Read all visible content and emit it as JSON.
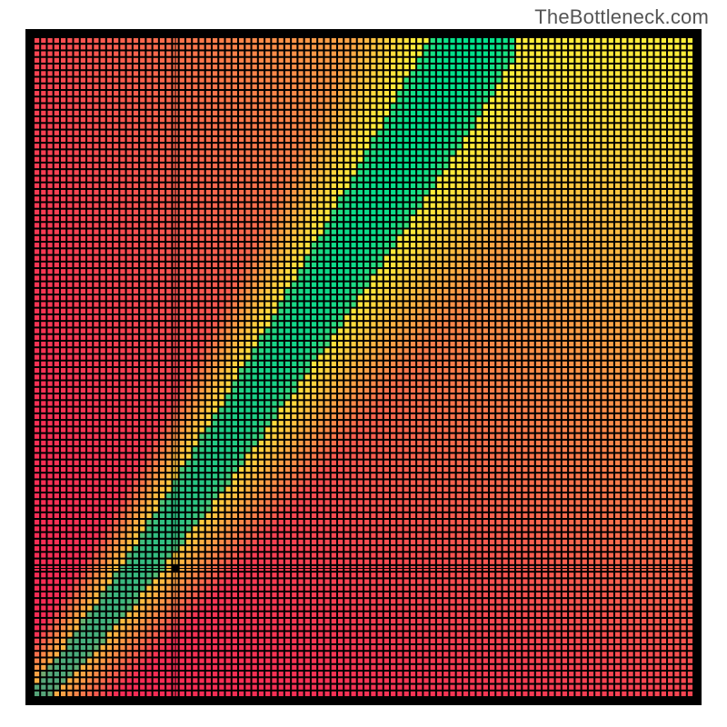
{
  "watermark": "TheBottleneck.com",
  "chart_data": {
    "type": "heatmap",
    "title": "",
    "xlabel": "",
    "ylabel": "",
    "grid": {
      "cells": 100,
      "inner_margin_frac": 0.012
    },
    "ridge": {
      "comment": "Green optimal band runs as a curve from bottom-left toward top-right with slope >1 (steeper than diagonal).",
      "x0": 0.0,
      "y0": 0.0,
      "x1": 0.67,
      "y1": 1.0,
      "curvature": 0.55,
      "width_start": 0.02,
      "width_end": 0.13
    },
    "background_gradient": {
      "comment": "Quadrilinear blend by corner color",
      "bottom_left": "#f72c56",
      "bottom_right": "#f72c56",
      "top_left": "#f72c56",
      "top_right": "#ffe93f"
    },
    "ridge_color": "#00e48d",
    "halo_color": "#fff23a",
    "crosshair": {
      "x_frac": 0.215,
      "y_frac": 0.195,
      "marker_radius_px": 4
    },
    "xlim": [
      0,
      1
    ],
    "ylim": [
      0,
      1
    ]
  }
}
